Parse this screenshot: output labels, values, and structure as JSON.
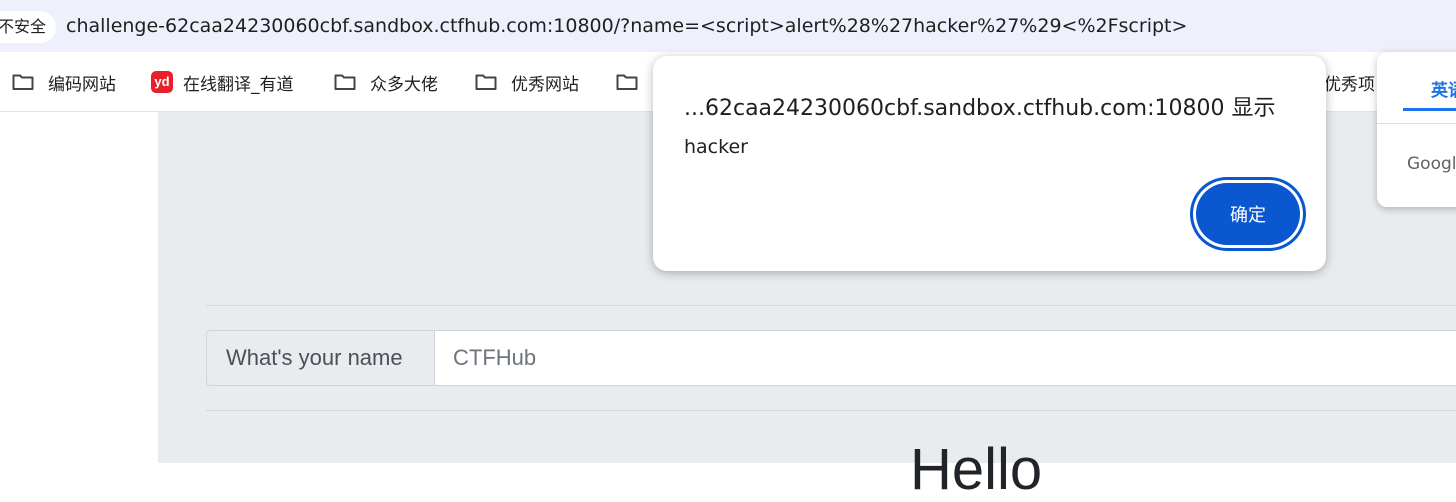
{
  "browser": {
    "security_label": "不安全",
    "url": "challenge-62caa24230060cbf.sandbox.ctfhub.com:10800/?name=<script>alert%28%27hacker%27%29<%2Fscript>"
  },
  "bookmarks": [
    {
      "label": "编码网站",
      "icon": "folder-icon"
    },
    {
      "label": "在线翻译_有道",
      "icon": "youdao-icon"
    },
    {
      "label": "众多大佬",
      "icon": "folder-icon"
    },
    {
      "label": "优秀网站",
      "icon": "folder-icon"
    },
    {
      "label": "",
      "icon": "folder-icon"
    },
    {
      "label": "优秀项",
      "icon": ""
    }
  ],
  "youdao_icon_text": "yd",
  "alert": {
    "origin": "...62caa24230060cbf.sandbox.ctfhub.com:10800 显示",
    "message": "hacker",
    "confirm_label": "确定"
  },
  "translate_popup": {
    "tab_label": "英语",
    "footer_label": "Google"
  },
  "form": {
    "label": "What's your name",
    "placeholder": "CTFHub",
    "value": ""
  },
  "page": {
    "greeting": "Hello"
  },
  "colors": {
    "accent": "#0b57d0",
    "jumbotron_bg": "#e9ecef",
    "address_bar_bg": "#eef1fb"
  }
}
